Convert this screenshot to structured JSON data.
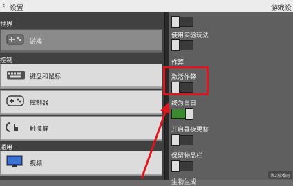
{
  "header": {
    "back_glyph": "‹",
    "title": "设置",
    "right_title": "游戏设"
  },
  "sections": {
    "world": "世界",
    "controls": "控制",
    "general": "通用"
  },
  "menu": [
    {
      "label": "游戏",
      "icon": "world-icon",
      "selected": true
    },
    {
      "label": "键盘和鼠标",
      "icon": "keyboard-icon",
      "selected": false
    },
    {
      "label": "控制器",
      "icon": "controller-icon",
      "selected": false
    },
    {
      "label": "触摸屏",
      "icon": "touch-icon",
      "selected": false
    },
    {
      "label": "视频",
      "icon": "monitor-icon",
      "selected": false
    }
  ],
  "options": {
    "experimental_label": "使用实验玩法",
    "cheats_section": "作弊",
    "activate_cheats_label": "激活作弊",
    "always_day_label": "终为白日",
    "daylight_cycle_label": "开启昼夜更替",
    "keep_inventory_label": "保留物品栏",
    "last_label": "生物生成"
  },
  "toggles": {
    "top": "off",
    "experimental": "off",
    "activate_cheats": "off",
    "always_day": "on",
    "daylight_cycle": "off",
    "keep_inventory": "off"
  },
  "colors": {
    "highlight": "#e0161f",
    "toggle_on": "#3c8a2e"
  },
  "watermark": "第2游戏网"
}
